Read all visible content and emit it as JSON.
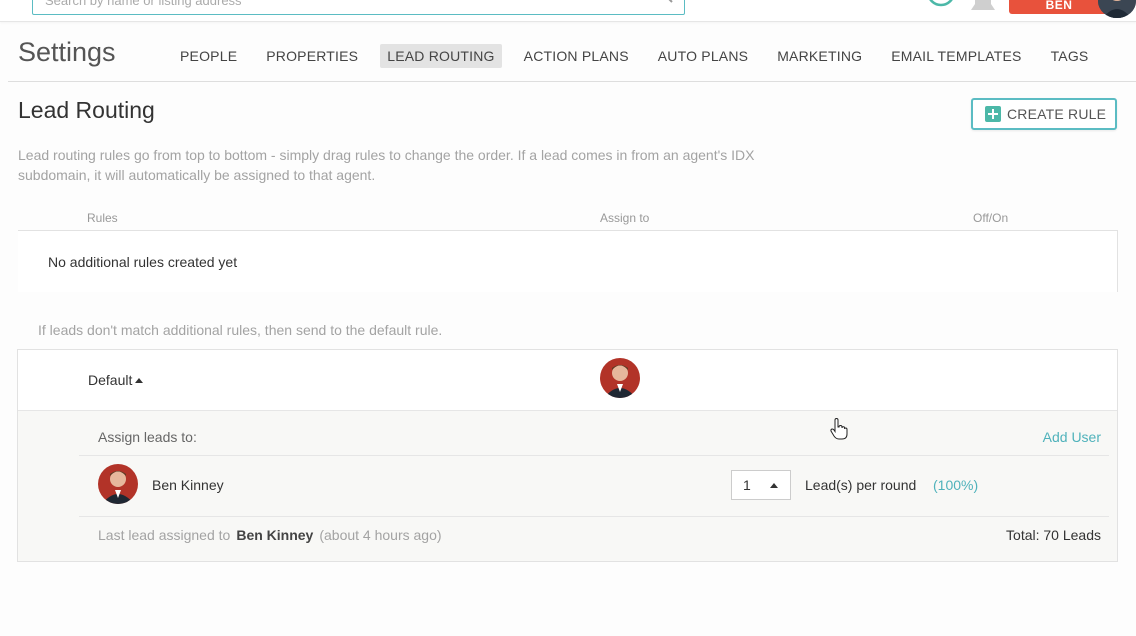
{
  "topbar": {
    "search_placeholder": "Search by name or listing address",
    "user_button_label": "BEN"
  },
  "settings": {
    "title": "Settings",
    "tabs": [
      {
        "label": "PEOPLE"
      },
      {
        "label": "PROPERTIES"
      },
      {
        "label": "LEAD ROUTING",
        "active": true
      },
      {
        "label": "ACTION PLANS"
      },
      {
        "label": "AUTO PLANS"
      },
      {
        "label": "MARKETING"
      },
      {
        "label": "EMAIL TEMPLATES"
      },
      {
        "label": "TAGS"
      }
    ]
  },
  "lead_routing": {
    "title": "Lead Routing",
    "create_rule_label": "CREATE RULE",
    "description": "Lead routing rules go from top to bottom - simply drag rules to change the order. If a lead comes in from an agent's IDX subdomain, it will automatically be assigned to that agent.",
    "columns": {
      "rules": "Rules",
      "assign_to": "Assign to",
      "off_on": "Off/On"
    },
    "empty_rules": "No additional rules created yet",
    "default_note": "If leads don't match additional rules, then send to the default rule.",
    "default_rule": {
      "label": "Default",
      "assign_label": "Assign leads to:",
      "add_user_label": "Add User",
      "user": {
        "name": "Ben Kinney",
        "leads_per_round": "1",
        "per_round_label": "Lead(s) per round",
        "percent": "(100%)"
      },
      "last_lead_prefix": "Last lead assigned to",
      "last_lead_name": "Ben Kinney",
      "last_lead_time": "(about 4 hours ago)",
      "total": "Total: 70 Leads"
    }
  },
  "colors": {
    "accent": "#5bbcc3",
    "brand_button": "#e8523c",
    "link": "#4fb2bb"
  }
}
